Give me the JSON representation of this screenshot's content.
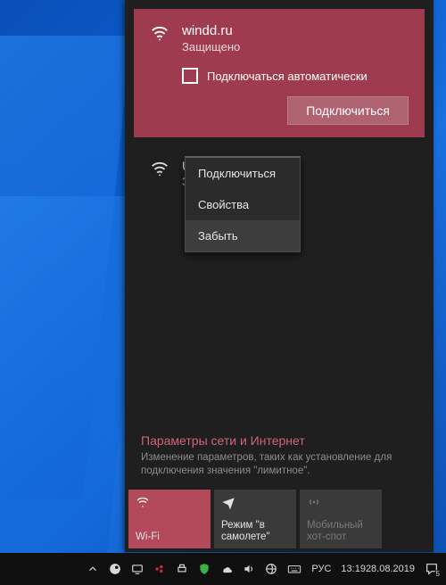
{
  "network1": {
    "ssid": "windd.ru",
    "status": "Защищено",
    "autoconnect_label": "Подключаться автоматически",
    "connect_label": "Подключиться"
  },
  "network2": {
    "ssid_partial": "UKr",
    "status_partial": "За"
  },
  "context_menu": {
    "items": [
      "Подключиться",
      "Свойства",
      "Забыть"
    ],
    "hovered_index": 2
  },
  "settings": {
    "title": "Параметры сети и Интернет",
    "subtitle": "Изменение параметров, таких как установление для подключения значения \"лимитное\"."
  },
  "tiles": {
    "wifi": "Wi-Fi",
    "airplane": "Режим \"в самолете\"",
    "hotspot": "Мобильный хот-спот"
  },
  "taskbar": {
    "lang": "РУС",
    "time": "13:19",
    "date": "28.08.2019",
    "notif_count": "5"
  }
}
